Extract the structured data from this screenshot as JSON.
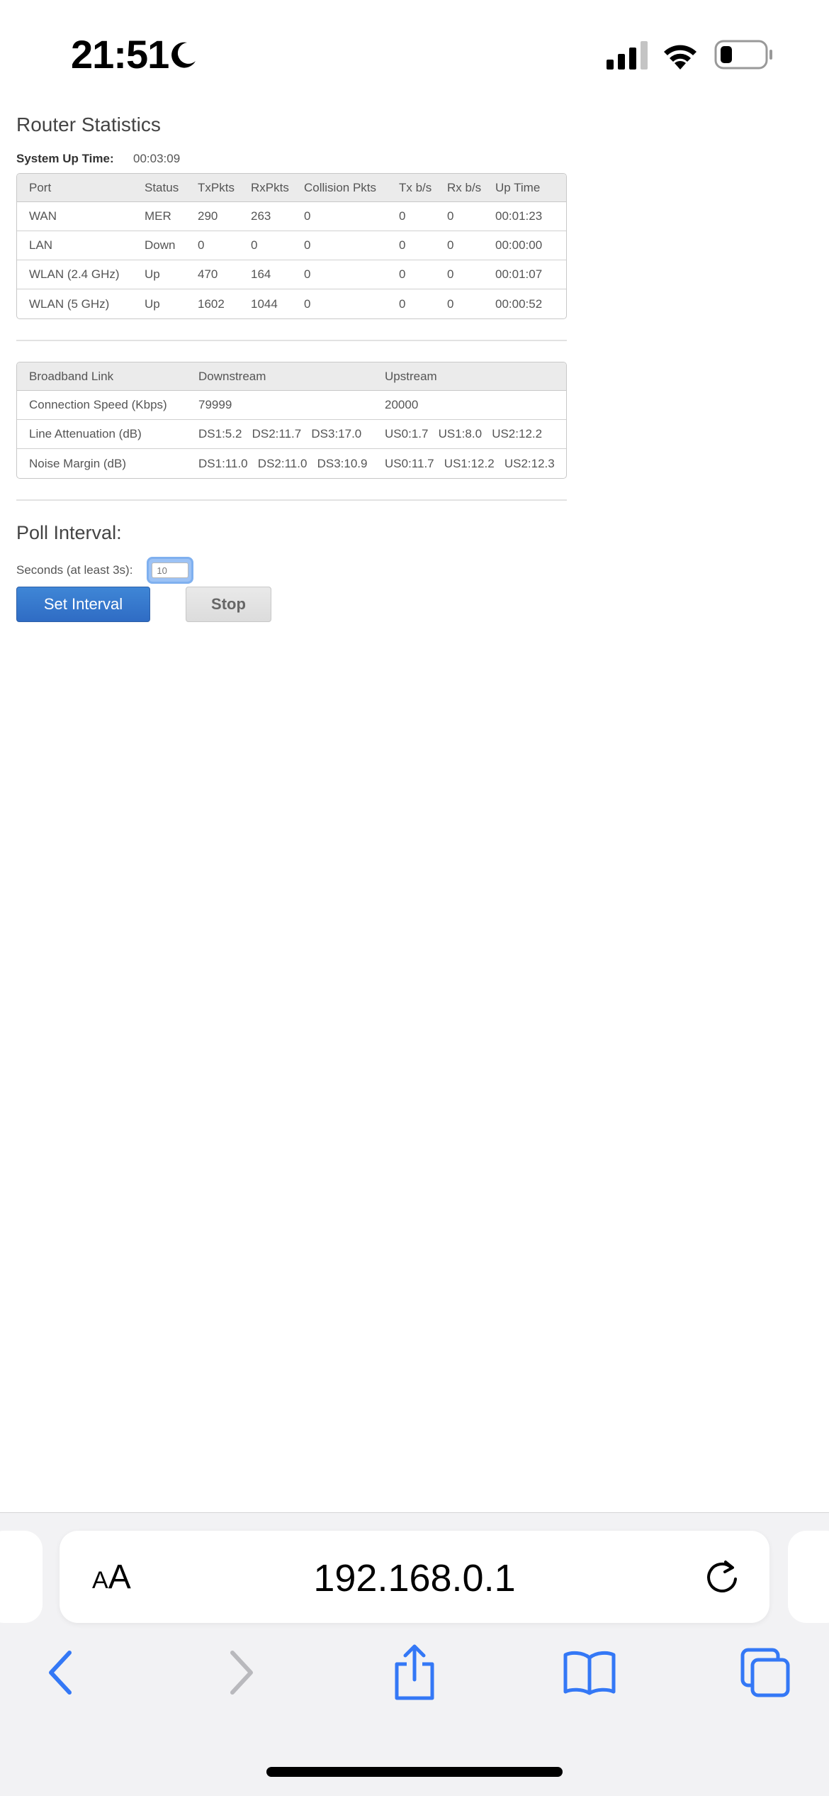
{
  "status_bar": {
    "time": "21:51"
  },
  "page": {
    "title": "Router Statistics",
    "system_up_time_label": "System Up Time:",
    "system_up_time_value": "00:03:09"
  },
  "port_table": {
    "headers": [
      "Port",
      "Status",
      "TxPkts",
      "RxPkts",
      "Collision Pkts",
      "Tx b/s",
      "Rx b/s",
      "Up Time"
    ],
    "rows": [
      [
        "WAN",
        "MER",
        "290",
        "263",
        "0",
        "0",
        "0",
        "00:01:23"
      ],
      [
        "LAN",
        "Down",
        "0",
        "0",
        "0",
        "0",
        "0",
        "00:00:00"
      ],
      [
        "WLAN (2.4 GHz)",
        "Up",
        "470",
        "164",
        "0",
        "0",
        "0",
        "00:01:07"
      ],
      [
        "WLAN (5 GHz)",
        "Up",
        "1602",
        "1044",
        "0",
        "0",
        "0",
        "00:00:52"
      ]
    ]
  },
  "broadband_table": {
    "headers": [
      "Broadband Link",
      "Downstream",
      "Upstream"
    ],
    "rows": [
      [
        "Connection Speed (Kbps)",
        "79999",
        "20000"
      ],
      [
        "Line Attenuation (dB)",
        "DS1:5.2   DS2:11.7   DS3:17.0",
        "US0:1.7   US1:8.0   US2:12.2"
      ],
      [
        "Noise Margin (dB)",
        "DS1:11.0   DS2:11.0   DS3:10.9",
        "US0:11.7   US1:12.2   US2:12.3"
      ]
    ]
  },
  "poll": {
    "title": "Poll Interval:",
    "seconds_label": "Seconds (at least 3s):",
    "seconds_value": "10",
    "set_button": "Set Interval",
    "stop_button": "Stop"
  },
  "browser": {
    "text_size_small": "A",
    "text_size_large": "A",
    "url": "192.168.0.1"
  },
  "icons": {
    "accent": "#3478f6"
  }
}
